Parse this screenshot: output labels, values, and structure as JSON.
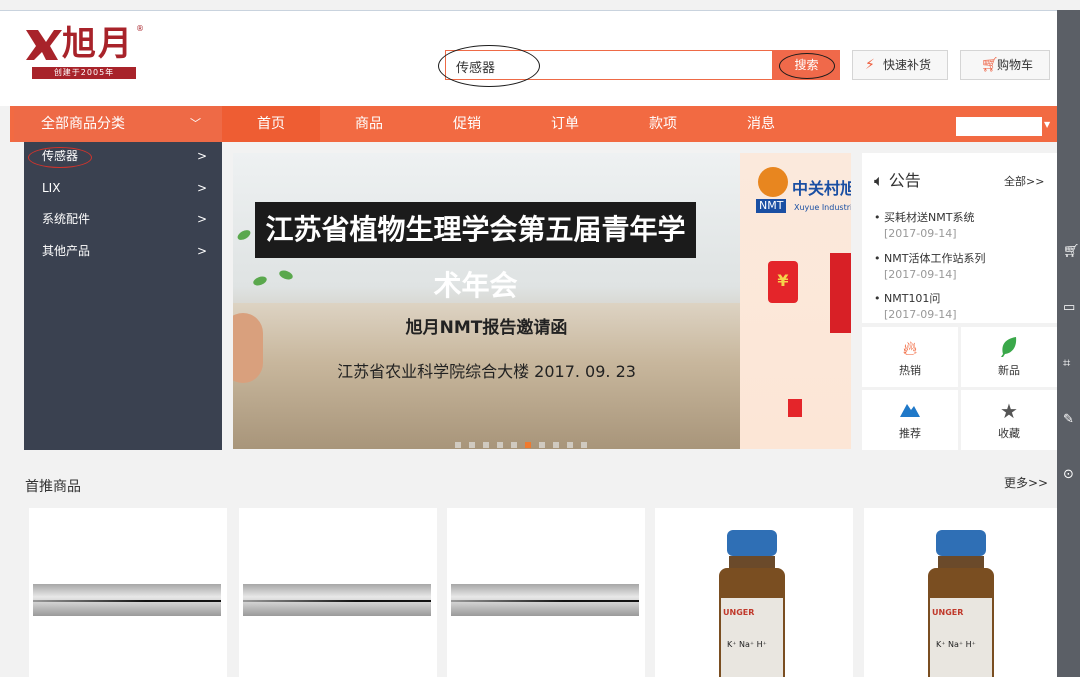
{
  "header": {
    "logo": {
      "text": "旭月",
      "registered": "®",
      "subtitle": "创建于2005年"
    },
    "search": {
      "value": "传感器",
      "button": "搜索"
    },
    "quick_restock": "快速补货",
    "cart": "购物车"
  },
  "nav": {
    "all_categories": "全部商品分类",
    "items": [
      "首页",
      "商品",
      "促销",
      "订单",
      "款项",
      "消息"
    ]
  },
  "sidebar": {
    "items": [
      {
        "label": "传感器"
      },
      {
        "label": "LIX"
      },
      {
        "label": "系统配件"
      },
      {
        "label": "其他产品"
      }
    ]
  },
  "banner": {
    "title": "江苏省植物生理学会第五届青年学术年会",
    "subtitle": "旭月NMT报告邀请函",
    "venue": "江苏省农业科学院综合大楼 2017. 09. 23",
    "slide_count": 10,
    "active_slide": 6
  },
  "ad": {
    "brand": "中关村旭",
    "badge": "NMT",
    "english": "Xuyue Industri",
    "yen": "¥"
  },
  "notice": {
    "title": "公告",
    "all_link": "全部>>",
    "items": [
      {
        "text": "买耗材送NMT系统",
        "date": "[2017-09-14]"
      },
      {
        "text": "NMT活体工作站系列",
        "date": "[2017-09-14]"
      },
      {
        "text": "NMT101问",
        "date": "[2017-09-14]"
      }
    ]
  },
  "quick_links": [
    {
      "label": "热销",
      "icon": "flame-icon",
      "color": "#f05a2c"
    },
    {
      "label": "新品",
      "icon": "leaf-icon",
      "color": "#3aa84a"
    },
    {
      "label": "推荐",
      "icon": "mountain-icon",
      "color": "#1f78c8"
    },
    {
      "label": "收藏",
      "icon": "star-icon",
      "color": "#555555"
    }
  ],
  "section": {
    "title": "首推商品",
    "more": "更多>>"
  },
  "products": [
    {
      "image": "needle-icon"
    },
    {
      "image": "needle-icon"
    },
    {
      "image": "needle-icon"
    },
    {
      "image": "bottle-icon",
      "label_brand": "UNGER",
      "label_ions": "K⁺ Na⁺ H⁺"
    },
    {
      "image": "bottle-icon",
      "label_brand": "UNGER",
      "label_ions": "K⁺ Na⁺ H⁺"
    }
  ],
  "right_toolbar": [
    "cart-icon",
    "chat-icon",
    "scan-icon",
    "edit-icon",
    "back-to-top-icon"
  ],
  "colors": {
    "accent": "#f26a42",
    "sidebar": "#3a4150",
    "right_bar": "#5b5f66"
  }
}
